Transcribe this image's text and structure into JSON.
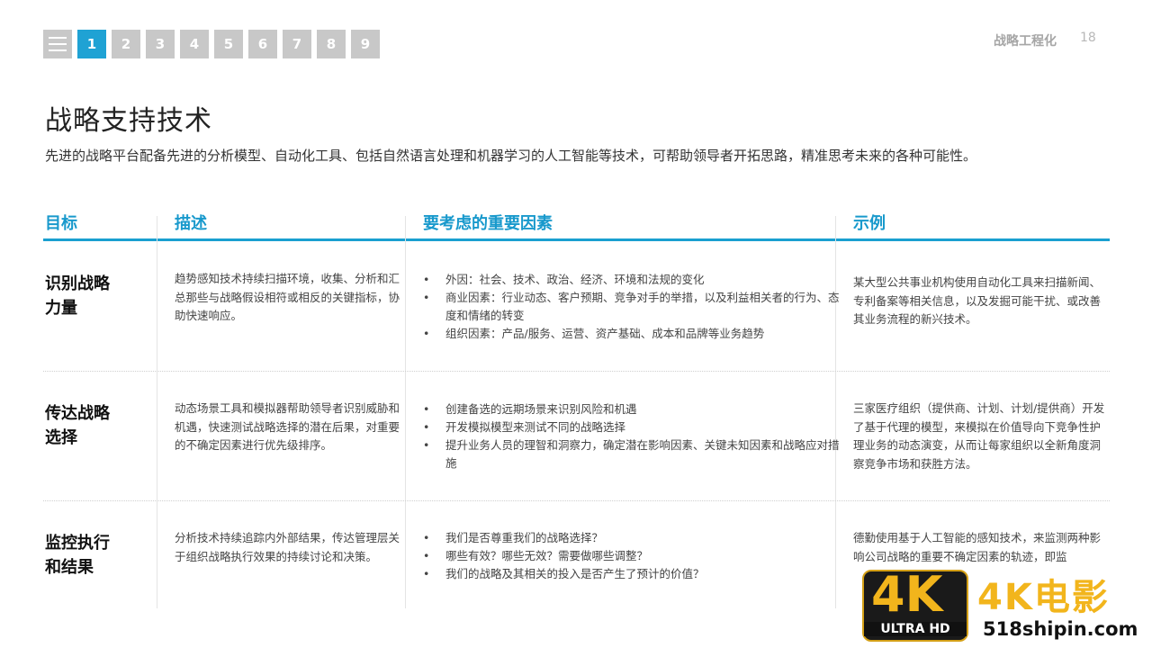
{
  "nav": {
    "pages": [
      "1",
      "2",
      "3",
      "4",
      "5",
      "6",
      "7",
      "8",
      "9"
    ],
    "active_index": 0
  },
  "header": {
    "section": "战略工程化",
    "page_number": "18"
  },
  "title": "战略支持技术",
  "subtitle": "先进的战略平台配备先进的分析模型、自动化工具、包括自然语言处理和机器学习的人工智能等技术，可帮助领导者开拓思路，精准思考未来的各种可能性。",
  "table": {
    "columns": [
      "目标",
      "描述",
      "要考虑的重要因素",
      "示例"
    ],
    "rows": [
      {
        "goal": "识别战略\n力量",
        "description": "趋势感知技术持续扫描环境，收集、分析和汇总那些与战略假设相符或相反的关键指标，协助快速响应。",
        "factors": [
          "外因：社会、技术、政治、经济、环境和法规的变化",
          "商业因素：行业动态、客户预期、竞争对手的举措，以及利益相关者的行为、态度和情绪的转变",
          "组织因素：产品/服务、运营、资产基础、成本和品牌等业务趋势"
        ],
        "example": "某大型公共事业机构使用自动化工具来扫描新闻、专利备案等相关信息，以及发掘可能干扰、或改善其业务流程的新兴技术。"
      },
      {
        "goal": "传达战略\n选择",
        "description": "动态场景工具和模拟器帮助领导者识别威胁和机遇，快速测试战略选择的潜在后果，对重要的不确定因素进行优先级排序。",
        "factors": [
          "创建备选的远期场景来识别风险和机遇",
          "开发模拟模型来测试不同的战略选择",
          "提升业务人员的理智和洞察力，确定潜在影响因素、关键未知因素和战略应对措施"
        ],
        "example": "三家医疗组织（提供商、计划、计划/提供商）开发了基于代理的模型，来模拟在价值导向下竞争性护理业务的动态演变，从而让每家组织以全新角度洞察竞争市场和获胜方法。"
      },
      {
        "goal": "监控执行\n和结果",
        "description": "分析技术持续追踪内外部结果，传达管理层关于组织战略执行效果的持续讨论和决策。",
        "factors": [
          "我们是否尊重我们的战略选择？",
          "哪些有效？哪些无效？需要做哪些调整？",
          "我们的战略及其相关的投入是否产生了预计的价值？"
        ],
        "example": "德勤使用基于人工智能的感知技术，来监测两种影响公司战略的重要不确定因素的轨迹，即监"
      }
    ]
  },
  "watermark": {
    "badge_big": "4K",
    "badge_small": "ULTRA HD",
    "text": "4K电影",
    "site": "518shipin.com"
  }
}
